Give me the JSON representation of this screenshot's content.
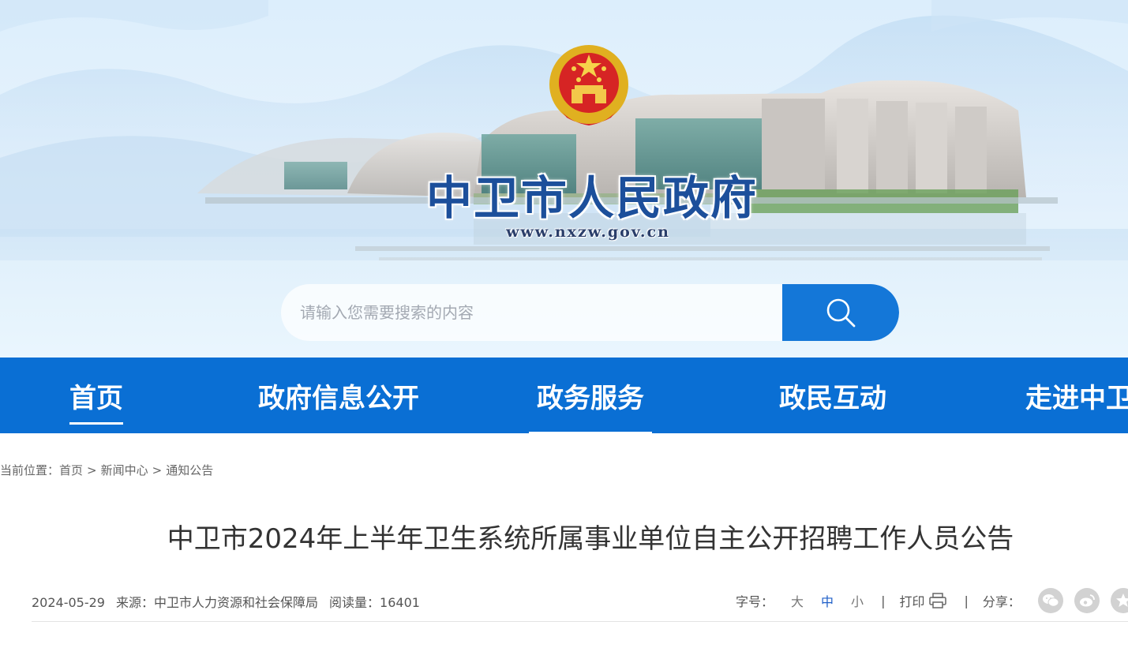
{
  "header": {
    "site_title": "中卫市人民政府",
    "site_url": "www.nxzw.gov.cn",
    "emblem_icon": "national-emblem-icon"
  },
  "search": {
    "placeholder": "请输入您需要搜索的内容",
    "value": "",
    "button_icon": "search-icon"
  },
  "nav": {
    "items": [
      {
        "label": "首页",
        "active": true
      },
      {
        "label": "政府信息公开",
        "active": false
      },
      {
        "label": "政务服务",
        "active": false
      },
      {
        "label": "政民互动",
        "active": false
      },
      {
        "label": "走进中卫",
        "active": false
      }
    ]
  },
  "breadcrumb": {
    "prefix": "当前位置：",
    "items": [
      "首页",
      "新闻中心",
      "通知公告"
    ],
    "separator": ">"
  },
  "article": {
    "title": "中卫市2024年上半年卫生系统所属事业单位自主公开招聘工作人员公告",
    "date": "2024-05-29",
    "source_label": "来源：",
    "source": "中卫市人力资源和社会保障局",
    "views_label": "阅读量：",
    "views": "16401"
  },
  "tools": {
    "font_size_label": "字号：",
    "font_sizes": [
      "大",
      "中",
      "小"
    ],
    "font_size_selected": "中",
    "divider": "|",
    "print_label": "打印",
    "share_label": "分享：",
    "share_icons": [
      "wechat-icon",
      "weibo-icon",
      "qzone-icon"
    ]
  },
  "colors": {
    "nav_bg": "#0a6fd4",
    "search_btn": "#1477d8",
    "title_blue": "#1c4f9b",
    "active_font_size": "#1f5fc8"
  }
}
